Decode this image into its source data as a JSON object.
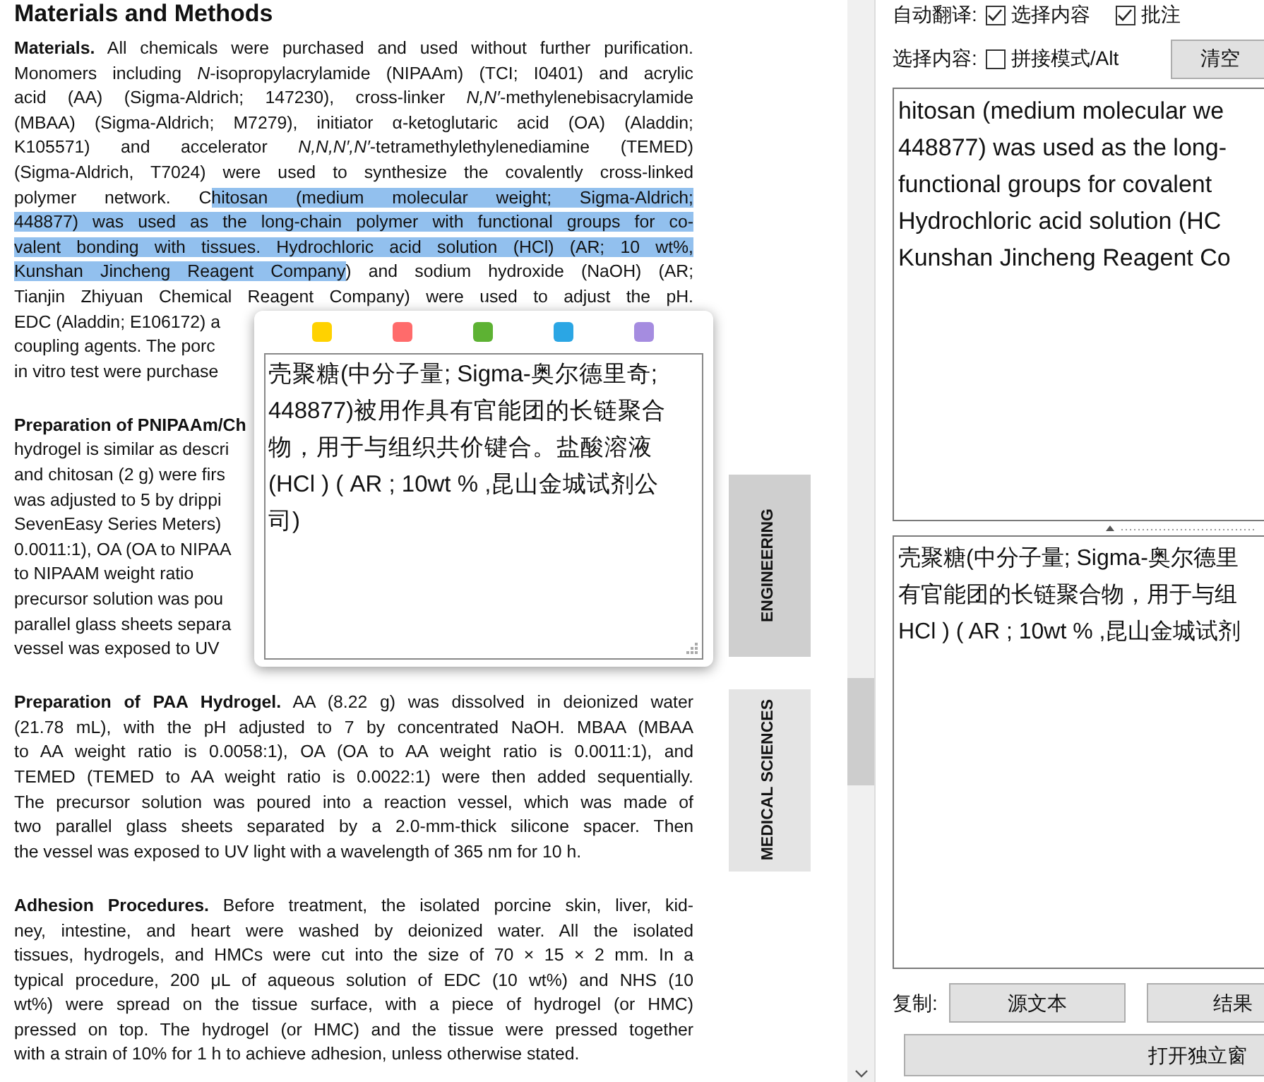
{
  "document": {
    "title": "Materials and Methods",
    "paragraphs": [
      {
        "lines": [
          {
            "kind": "full",
            "text": "**Materials.** All chemicals were purchased and used without further purification."
          },
          {
            "kind": "full",
            "text": "Monomers including *N*-isopropylacrylamide (NIPAAm) (TCI; I0401) and acrylic"
          },
          {
            "kind": "full",
            "text": "acid (AA) (Sigma-Aldrich; 147230), cross-linker *N,N′*-methylenebisacrylamide"
          },
          {
            "kind": "full",
            "text": "(MBAA) (Sigma-Aldrich; M7279), initiator α-ketoglutaric acid (OA) (Aladdin;"
          },
          {
            "kind": "full",
            "text": "K105571) and accelerator *N,N,N′,N′*-tetramethylethylenediamine (TEMED)"
          },
          {
            "kind": "full",
            "text": "(Sigma-Aldrich, T7024) were used to synthesize the covalently cross-linked"
          },
          {
            "kind": "full",
            "segments": [
              {
                "text": "polymer network. C",
                "highlighted": false
              },
              {
                "text": "hitosan (medium molecular weight; Sigma-Aldrich;",
                "highlighted": true
              }
            ]
          },
          {
            "kind": "full",
            "segments": [
              {
                "text": "448877) was used as the long-chain polymer with functional groups for co-",
                "highlighted": true
              }
            ]
          },
          {
            "kind": "full",
            "segments": [
              {
                "text": "valent bonding with tissues. Hydrochloric acid solution (HCl) (AR; 10 wt%,",
                "highlighted": true
              }
            ]
          },
          {
            "kind": "full",
            "segments": [
              {
                "text": "Kunshan Jincheng Reagent Company",
                "highlighted": true
              },
              {
                "text": ") and sodium hydroxide (NaOH) (AR;",
                "highlighted": false
              }
            ]
          },
          {
            "kind": "full",
            "text": "Tianjin Zhiyuan Chemical Reagent Company) were used to adjust the pH."
          },
          {
            "kind": "covered",
            "text": "EDC (Aladdin; E106172) a"
          },
          {
            "kind": "covered",
            "text": "coupling agents. The porc"
          },
          {
            "kind": "covered",
            "text": "in vitro test were purchase"
          }
        ]
      },
      {
        "lines": [
          {
            "kind": "covered",
            "text": "**Preparation of PNIPAAm/Ch**"
          },
          {
            "kind": "covered",
            "text": "hydrogel is similar as descri"
          },
          {
            "kind": "covered",
            "text": "and chitosan (2 g) were firs"
          },
          {
            "kind": "covered",
            "text": "was adjusted to 5 by drippi"
          },
          {
            "kind": "covered",
            "text": "SevenEasy Series Meters)"
          },
          {
            "kind": "covered",
            "text": "0.0011:1), OA (OA to NIPAA"
          },
          {
            "kind": "covered",
            "text": "to NIPAAM weight ratio"
          },
          {
            "kind": "covered",
            "text": "precursor solution was pou"
          },
          {
            "kind": "covered",
            "text": "parallel glass sheets separa"
          },
          {
            "kind": "covered",
            "text": "vessel was exposed to UV"
          }
        ]
      },
      {
        "lines": [
          {
            "kind": "full",
            "text": "**Preparation of PAA Hydrogel.** AA (8.22 g) was dissolved in deionized water"
          },
          {
            "kind": "full",
            "text": "(21.78 mL), with the pH adjusted to 7 by concentrated NaOH. MBAA (MBAA"
          },
          {
            "kind": "full",
            "text": "to AA weight ratio is 0.0058:1), OA (OA to AA weight ratio is 0.0011:1), and"
          },
          {
            "kind": "full",
            "text": "TEMED (TEMED to AA weight ratio is 0.0022:1) were then added sequentially."
          },
          {
            "kind": "full",
            "text": "The precursor solution was poured into a reaction vessel, which was made of"
          },
          {
            "kind": "full",
            "text": "two parallel glass sheets separated by a 2.0-mm-thick silicone spacer. Then"
          },
          {
            "kind": "last",
            "text": "the vessel was exposed to UV light with a wavelength of 365 nm for 10 h."
          }
        ]
      },
      {
        "lines": [
          {
            "kind": "full",
            "text": "**Adhesion Procedures.** Before treatment, the isolated porcine skin, liver, kid-"
          },
          {
            "kind": "full",
            "text": "ney, intestine, and heart were washed by deionized water. All the isolated"
          },
          {
            "kind": "full",
            "text": "tissues, hydrogels, and HMCs were cut into the size of 70 × 15 × 2 mm. In a"
          },
          {
            "kind": "full",
            "text": "typical procedure, 200 μL of aqueous solution of EDC (10 wt%) and NHS (10"
          },
          {
            "kind": "full",
            "text": "wt%) were spread on the tissue surface, with a piece of hydrogel (or HMC)"
          },
          {
            "kind": "full",
            "text": "pressed on top. The hydrogel (or HMC) and the tissue were pressed together"
          },
          {
            "kind": "last",
            "text": "with a strain of 10% for 1 h to achieve adhesion, unless otherwise stated."
          }
        ]
      }
    ]
  },
  "side_tabs": [
    {
      "label": "ENGINEERING",
      "selected": true
    },
    {
      "label": "MEDICAL SCIENCES",
      "selected": false
    }
  ],
  "popup": {
    "colors": [
      {
        "color": "#ffd200"
      },
      {
        "color": "#ff6b6b"
      },
      {
        "color": "#5db233"
      },
      {
        "color": "#2ba6e4"
      },
      {
        "color": "#a58ce0"
      }
    ],
    "translation": "壳聚糖(中分子量; Sigma-奥尔德里奇; 448877)被用作具有官能团的长链聚合物，用于与组织共价键合。盐酸溶液(HCl ) ( AR ; 10wt % ,昆山金城试剂公司)"
  },
  "translator": {
    "auto_translate_label": "自动翻译:",
    "auto_options": [
      {
        "label": "选择内容",
        "checked": true
      },
      {
        "label": "批注",
        "checked": true
      }
    ],
    "select_label": "选择内容:",
    "splice_option": {
      "label": "拼接模式/Alt",
      "checked": false
    },
    "clear_button": "清空",
    "source_lines": [
      "hitosan (medium molecular we",
      "448877) was used as the long-",
      "functional groups for covalent",
      "Hydrochloric acid solution (HC",
      "Kunshan Jincheng Reagent Co"
    ],
    "result_lines": [
      "壳聚糖(中分子量; Sigma-奥尔德里",
      "有官能团的长链聚合物，用于与组",
      "HCl ) ( AR ; 10wt % ,昆山金城试剂"
    ],
    "copy_label": "复制:",
    "copy_buttons": [
      "源文本",
      "结果"
    ],
    "open_window_button": "打开独立窗"
  }
}
